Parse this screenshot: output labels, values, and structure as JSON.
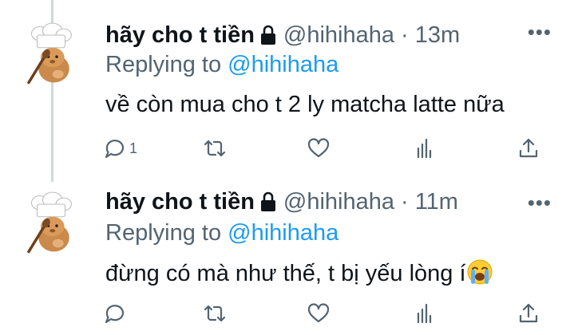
{
  "tweets": [
    {
      "name": "hãy cho t tiền",
      "handle": "@hihihaha",
      "dot": "·",
      "time": "13m",
      "more": "•••",
      "replying_label": "Replying to",
      "replying_to": "@hihihaha",
      "text": "về còn mua cho t 2 ly matcha latte nữa",
      "reply_count": "1"
    },
    {
      "name": "hãy cho t tiền",
      "handle": "@hihihaha",
      "dot": "·",
      "time": "11m",
      "more": "•••",
      "replying_label": "Replying to",
      "replying_to": "@hihihaha",
      "text": "đừng có mà như thế, t bị yếu lòng í",
      "emoji": "loudly-crying-face-emoji",
      "reply_count": ""
    }
  ],
  "icons": {
    "avatar": "chef-cat-avatar",
    "lock": "lock-icon",
    "reply": "reply-icon",
    "retweet": "retweet-icon",
    "like": "like-icon",
    "views": "views-icon",
    "share": "share-icon"
  },
  "colors": {
    "text": "#0f1419",
    "secondary": "#536471",
    "link": "#1d9bf0",
    "thread_line": "#cfd9de"
  }
}
